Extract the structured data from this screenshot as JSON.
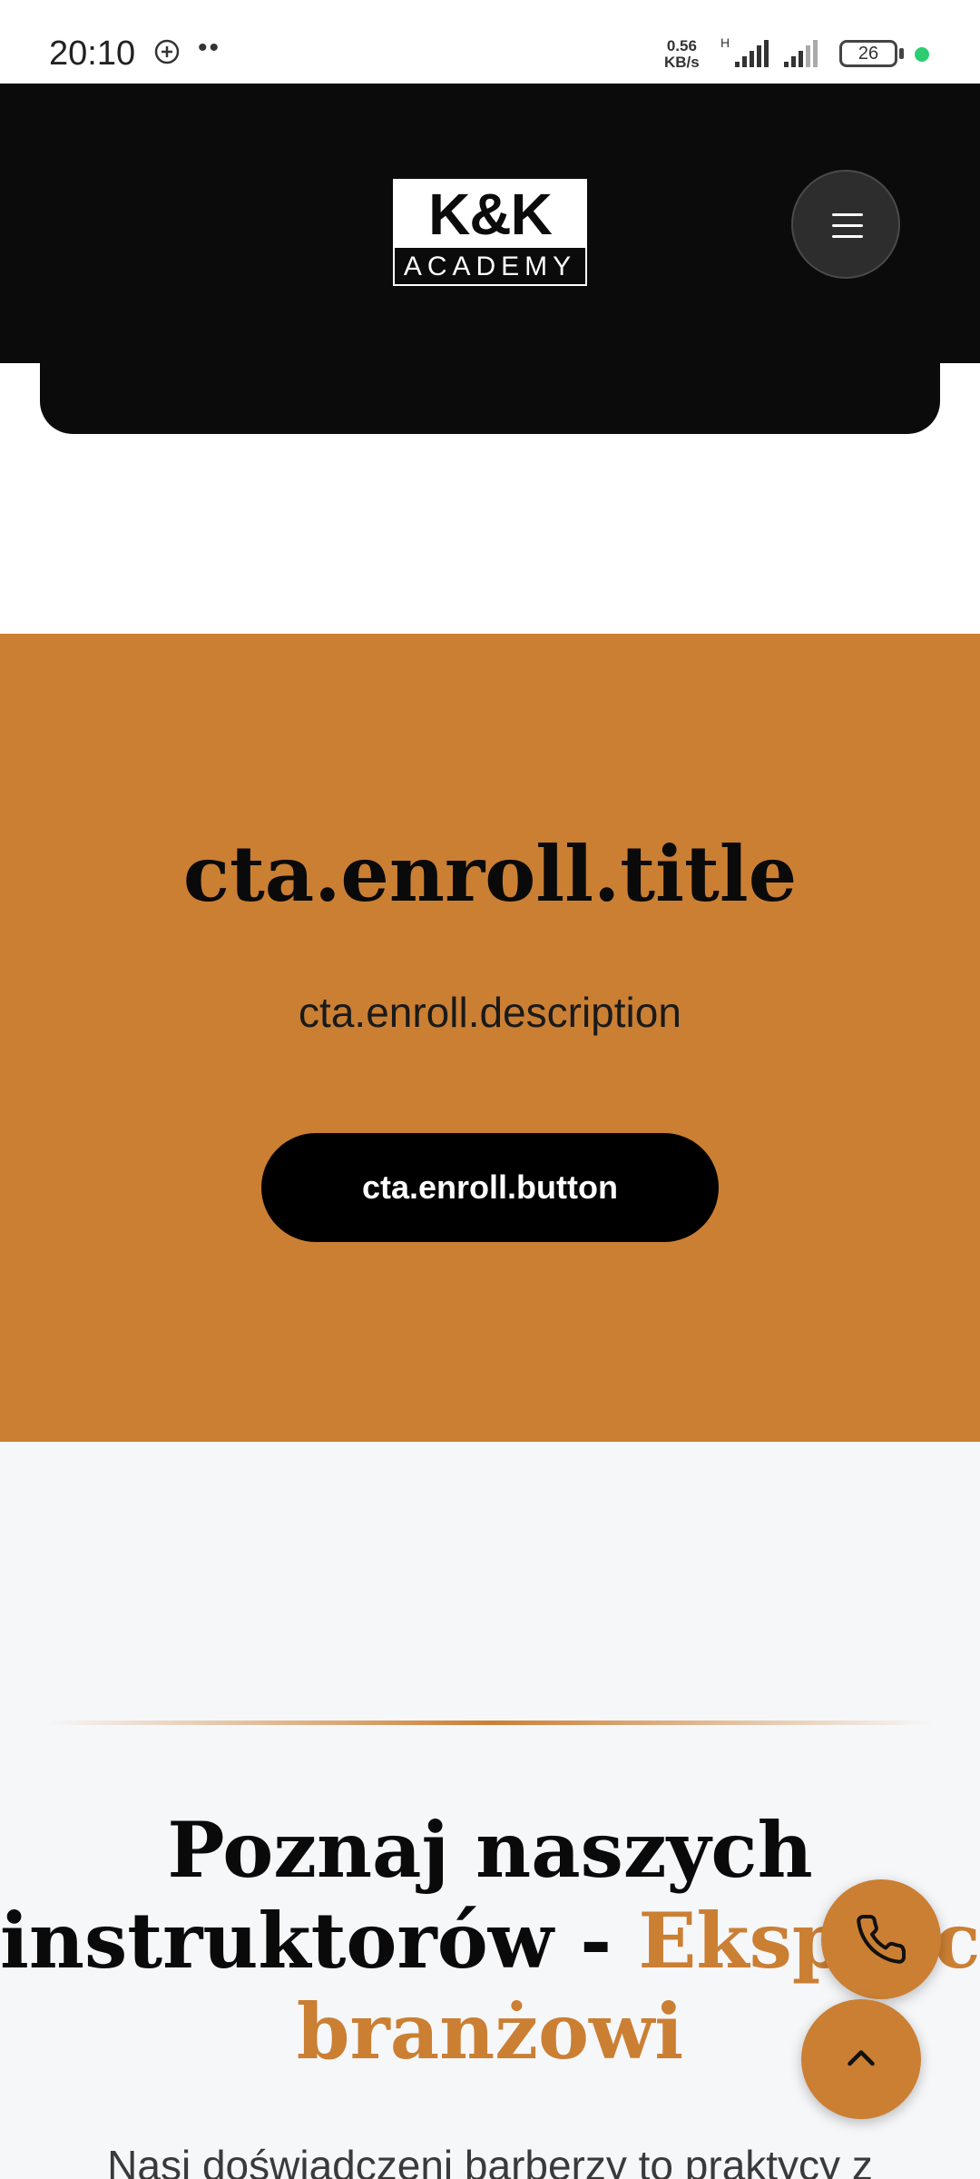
{
  "status_bar": {
    "time": "20:10",
    "network_speed_value": "0.56",
    "network_speed_unit": "KB/s",
    "network_type": "H",
    "battery": "26",
    "icons": [
      "message-plus-icon",
      "signal-icon",
      "battery-icon"
    ]
  },
  "header": {
    "logo_top": "K&K",
    "logo_bottom": "ACADEMY",
    "menu_icon": "hamburger-icon"
  },
  "cta": {
    "title": "cta.enroll.title",
    "description": "cta.enroll.description",
    "button": "cta.enroll.button"
  },
  "instructors": {
    "heading_line1": "Poznaj naszych",
    "heading_line2_start": "instruktorów - ",
    "heading_line2_accent": "Eksperci",
    "heading_line3_accent": "branżowi",
    "subtitle": "Nasi doświadczeni barberzy to praktycy z"
  },
  "floating": {
    "phone_icon": "phone-icon",
    "scroll_top_icon": "chevron-up-icon"
  },
  "colors": {
    "accent": "#cb7f33",
    "header_bg": "#0b0b0b",
    "section_bg": "#f6f7f9"
  }
}
